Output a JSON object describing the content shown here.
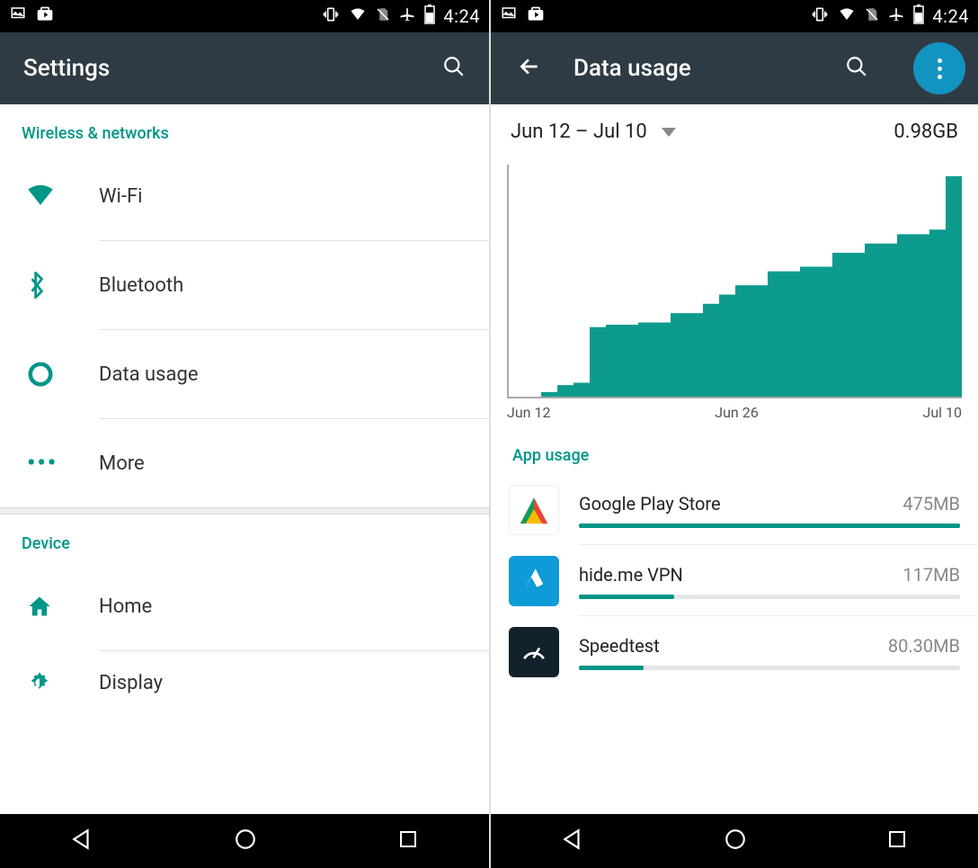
{
  "status": {
    "time": "4:24"
  },
  "left": {
    "title": "Settings",
    "sections": [
      {
        "name": "Wireless & networks",
        "items": [
          {
            "label": "Wi-Fi"
          },
          {
            "label": "Bluetooth"
          },
          {
            "label": "Data usage"
          },
          {
            "label": "More"
          }
        ]
      },
      {
        "name": "Device",
        "items": [
          {
            "label": "Home"
          },
          {
            "label": "Display"
          }
        ]
      }
    ]
  },
  "right": {
    "title": "Data usage",
    "range": "Jun 12 – Jul 10",
    "total": "0.98GB",
    "app_usage_header": "App usage",
    "apps": [
      {
        "name": "Google Play Store",
        "value_label": "475MB",
        "pct": 100
      },
      {
        "name": "hide.me VPN",
        "value_label": "117MB",
        "pct": 25
      },
      {
        "name": "Speedtest",
        "value_label": "80.30MB",
        "pct": 17
      }
    ]
  },
  "chart_data": {
    "type": "area",
    "xlabel": "",
    "ylabel": "",
    "x_tick_labels": [
      "Jun 12",
      "Jun 26",
      "Jul 10"
    ],
    "title": "",
    "ylim": [
      0,
      1.0
    ],
    "x": [
      0,
      2,
      3,
      4,
      5,
      6,
      8,
      10,
      12,
      13,
      14,
      16,
      18,
      20,
      22,
      24,
      26,
      27,
      28
    ],
    "y": [
      0.0,
      0.02,
      0.05,
      0.06,
      0.3,
      0.31,
      0.32,
      0.36,
      0.4,
      0.44,
      0.48,
      0.54,
      0.56,
      0.62,
      0.66,
      0.7,
      0.72,
      0.95,
      0.98
    ]
  }
}
